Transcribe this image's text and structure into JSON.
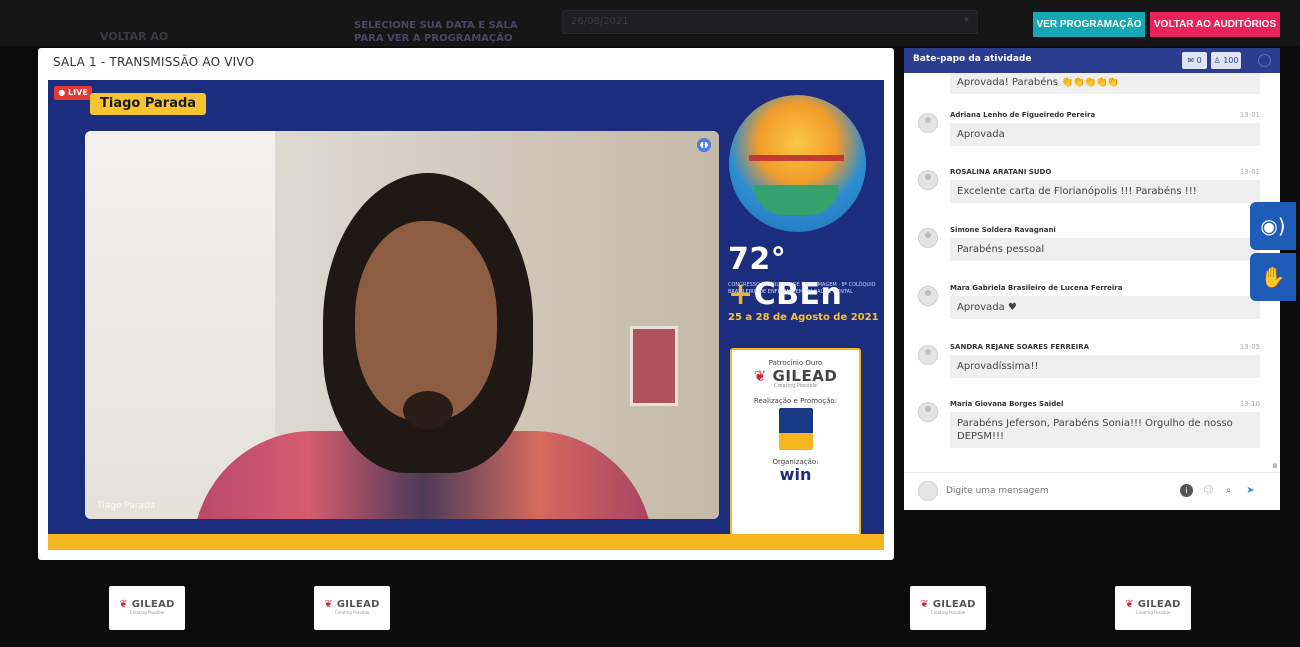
{
  "topbar": {
    "back_label": "VOLTAR AO",
    "select_hint": "SELECIONE SUA DATA E SALA PARA VER A PROGRAMAÇÃO",
    "date_value": "26/08/2021",
    "btn_programacao": "VER PROGRAMAÇÃO",
    "btn_auditorios": "VOLTAR AO AUDITÓRIOS"
  },
  "panel": {
    "title": "SALA 1 - TRANSMISSÃO AO VIVO",
    "live_badge": "● LIVE",
    "speaker_name": "Tiago Parada",
    "camera_label": "Tiago Parada",
    "brand_title_a": "72°",
    "brand_title_b": "CBEn",
    "brand_subtitle": "CONGRESSO BRASILEIRO DE ENFERMAGEM · 8º COLÓQUIO BRASILEIRO DE ENFERMAGEM EM SAÚDE MENTAL",
    "brand_dates": "25 a 28 de Agosto de 2021",
    "sponsor_label": "Patrocínio Ouro",
    "sponsor_name": "GILEAD",
    "sponsor_tagline": "Creating Possible",
    "realizacao_label": "Realização e Promoção:",
    "organizacao_label": "Organização:",
    "organizer_name": "win"
  },
  "chat": {
    "title": "Bate-papo da atividade",
    "count_messages": "0",
    "count_users": "100",
    "messages": [
      {
        "author": "",
        "time": "",
        "text": "Aprovada! Parabéns",
        "emoji": "👏👏👏👏👏"
      },
      {
        "author": "Adriana Lenho de Figueiredo Pereira",
        "time": "13:01",
        "text": "Aprovada"
      },
      {
        "author": "ROSALINA ARATANI SUDO",
        "time": "13:01",
        "text": "Excelente carta de Florianópolis !!! Parabéns !!!"
      },
      {
        "author": "Simone Soldera Ravagnani",
        "time": "13",
        "text": "Parabéns pessoal"
      },
      {
        "author": "Mara Gabriela Brasileiro de Lucena Ferreira",
        "time": "13",
        "text": "Aprovada ♥"
      },
      {
        "author": "SANDRA REJANE SOARES FERREIRA",
        "time": "13:05",
        "text": "Aprovadíssima!!"
      },
      {
        "author": "Maria Giovana Borges Saidel",
        "time": "13:10",
        "text": "Parabéns Jeferson, Parabéns Sonia!!! Orgulho de nosso DEPSM!!!"
      }
    ],
    "input_placeholder": "Digite uma mensagem"
  },
  "footer": {
    "sponsors": [
      {
        "name": "GILEAD",
        "tagline": "Creating Possible"
      },
      {
        "name": "GILEAD",
        "tagline": "Creating Possible"
      },
      {
        "name": "GILEAD",
        "tagline": "Creating Possible"
      },
      {
        "name": "GILEAD",
        "tagline": "Creating Possible"
      }
    ]
  },
  "colors": {
    "accent_teal": "#16a7b5",
    "accent_pink": "#e8225a",
    "brand_blue": "#1b2d7c",
    "chat_header": "#2c3d8f",
    "brand_yellow": "#f5b51e"
  },
  "icons": {
    "audio_description": "audio-description-icon",
    "sign_language": "sign-language-icon"
  }
}
